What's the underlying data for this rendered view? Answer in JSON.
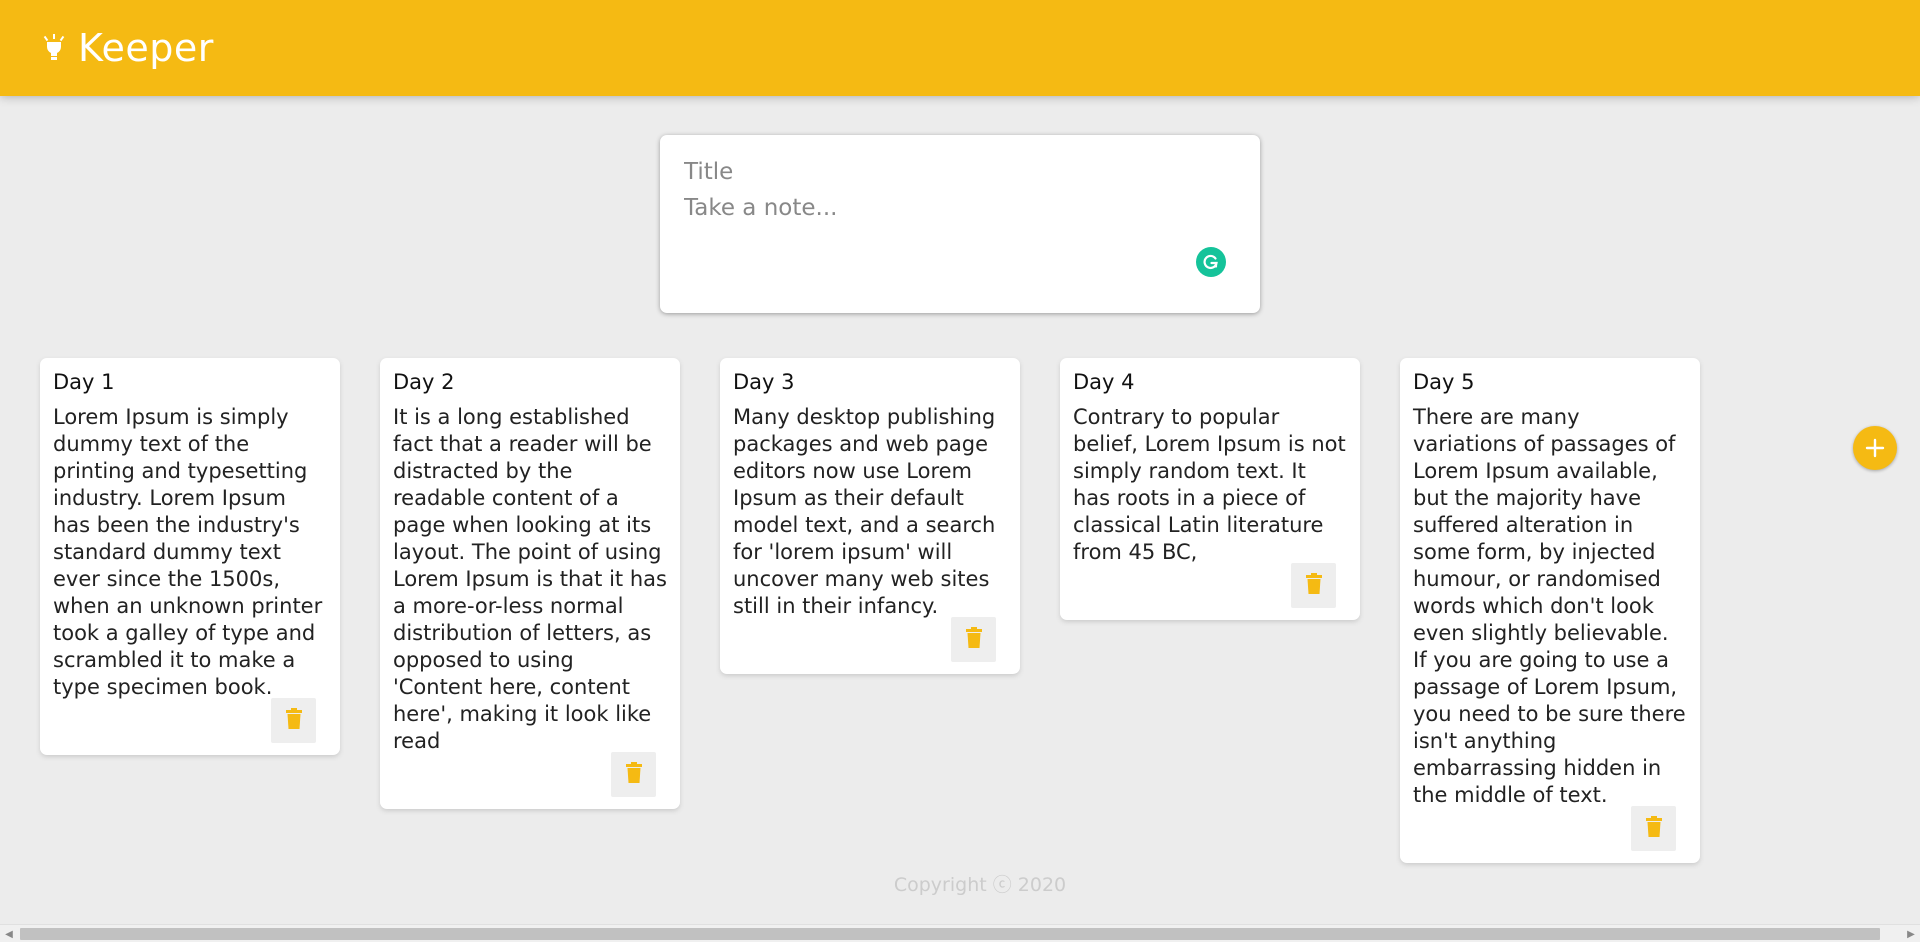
{
  "header": {
    "title": "Keeper",
    "logo_icon": "lightbulb-icon",
    "color": "#f5ba13"
  },
  "create_note": {
    "title_placeholder": "Title",
    "content_placeholder": "Take a note...",
    "add_icon": "plus-icon",
    "grammarly_icon": "grammarly-icon"
  },
  "notes": [
    {
      "title": "Day 1",
      "content": "Lorem Ipsum is simply dummy text of the printing and typesetting industry. Lorem Ipsum has been the industry's standard dummy text ever since the 1500s, when an unknown printer took a galley of type and scrambled it to make a type specimen book."
    },
    {
      "title": "Day 2",
      "content": "It is a long established fact that a reader will be distracted by the readable content of a page when looking at its layout. The point of using Lorem Ipsum is that it has a more-or-less normal distribution of letters, as opposed to using 'Content here, content here', making it look like read"
    },
    {
      "title": "Day 3",
      "content": "Many desktop publishing packages and web page editors now use Lorem Ipsum as their default model text, and a search for 'lorem ipsum' will uncover many web sites still in their infancy."
    },
    {
      "title": "Day 4",
      "content": "Contrary to popular belief, Lorem Ipsum is not simply random text. It has roots in a piece of classical Latin literature from 45 BC,"
    },
    {
      "title": "Day 5",
      "content": "There are many variations of passages of Lorem Ipsum available, but the majority have suffered alteration in some form, by injected humour, or randomised words which don't look even slightly believable. If you are going to use a passage of Lorem Ipsum, you need to be sure there isn't anything embarrassing hidden in the middle of text."
    }
  ],
  "footer": {
    "copyright": "Copyright ⓒ 2020"
  },
  "colors": {
    "accent": "#f5ba13",
    "background": "#ececec",
    "grammarly": "#15c39a"
  }
}
